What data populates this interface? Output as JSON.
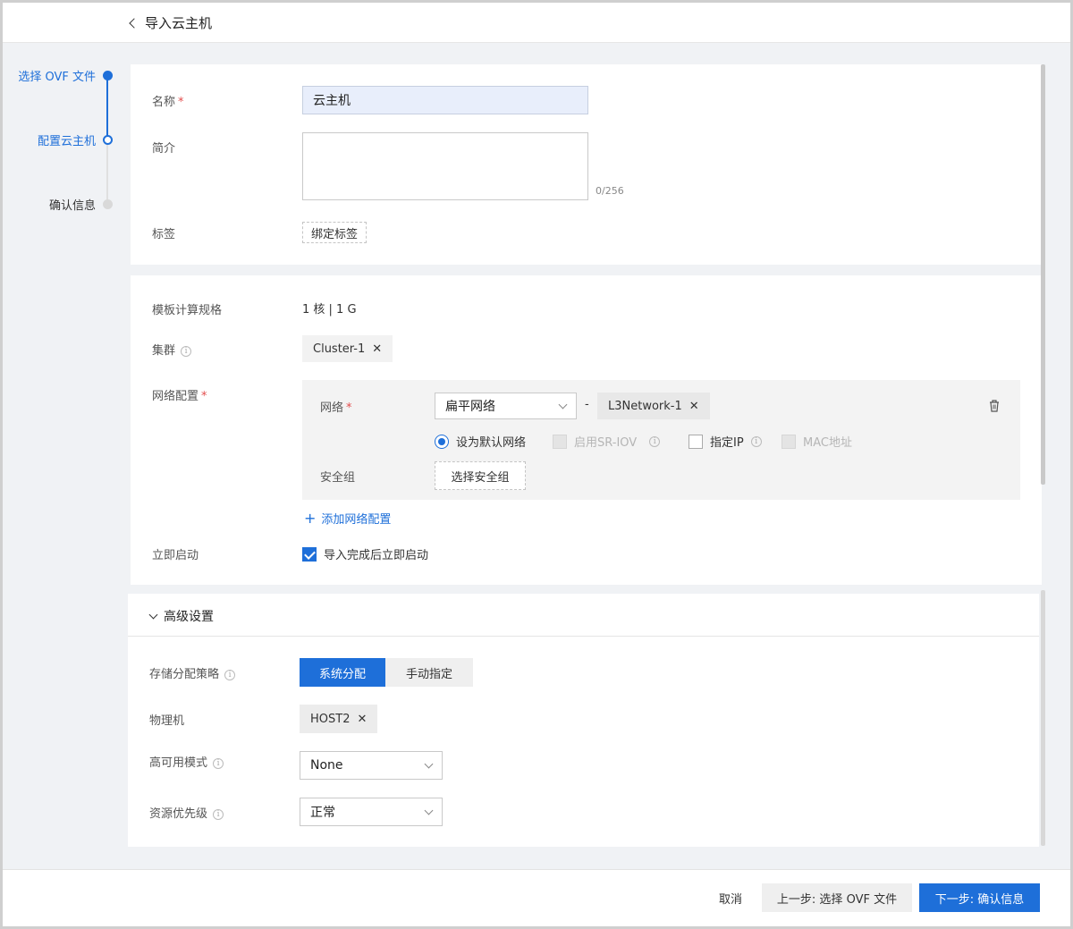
{
  "header": {
    "title": "导入云主机"
  },
  "steps": [
    {
      "label": "选择 OVF 文件",
      "state": "done"
    },
    {
      "label": "配置云主机",
      "state": "current"
    },
    {
      "label": "确认信息",
      "state": "todo"
    }
  ],
  "basic": {
    "name_label": "名称",
    "name_value": "云主机",
    "desc_label": "简介",
    "desc_value": "",
    "desc_counter": "0/256",
    "tag_label": "标签",
    "tag_button": "绑定标签"
  },
  "compute": {
    "spec_label": "模板计算规格",
    "spec_value": "1 核 | 1 G",
    "cluster_label": "集群",
    "cluster_tag": "Cluster-1",
    "network_config_label": "网络配置",
    "network_label": "网络",
    "network_type": "扁平网络",
    "network_separator": "-",
    "network_tag": "L3Network-1",
    "opt_default_network": "设为默认网络",
    "opt_sriov": "启用SR-IOV",
    "opt_static_ip": "指定IP",
    "opt_mac": "MAC地址",
    "security_group_label": "安全组",
    "security_group_button": "选择安全组",
    "add_network": "添加网络配置",
    "start_label": "立即启动",
    "start_option": "导入完成后立即启动"
  },
  "advanced": {
    "title": "高级设置",
    "storage_label": "存储分配策略",
    "storage_options": [
      "系统分配",
      "手动指定"
    ],
    "storage_selected": "系统分配",
    "host_label": "物理机",
    "host_tag": "HOST2",
    "ha_label": "高可用模式",
    "ha_value": "None",
    "priority_label": "资源优先级",
    "priority_value": "正常"
  },
  "footer": {
    "cancel": "取消",
    "prev": "上一步: 选择 OVF 文件",
    "next": "下一步: 确认信息"
  },
  "colors": {
    "primary": "#1e6fd9",
    "required": "#e34d4d"
  }
}
